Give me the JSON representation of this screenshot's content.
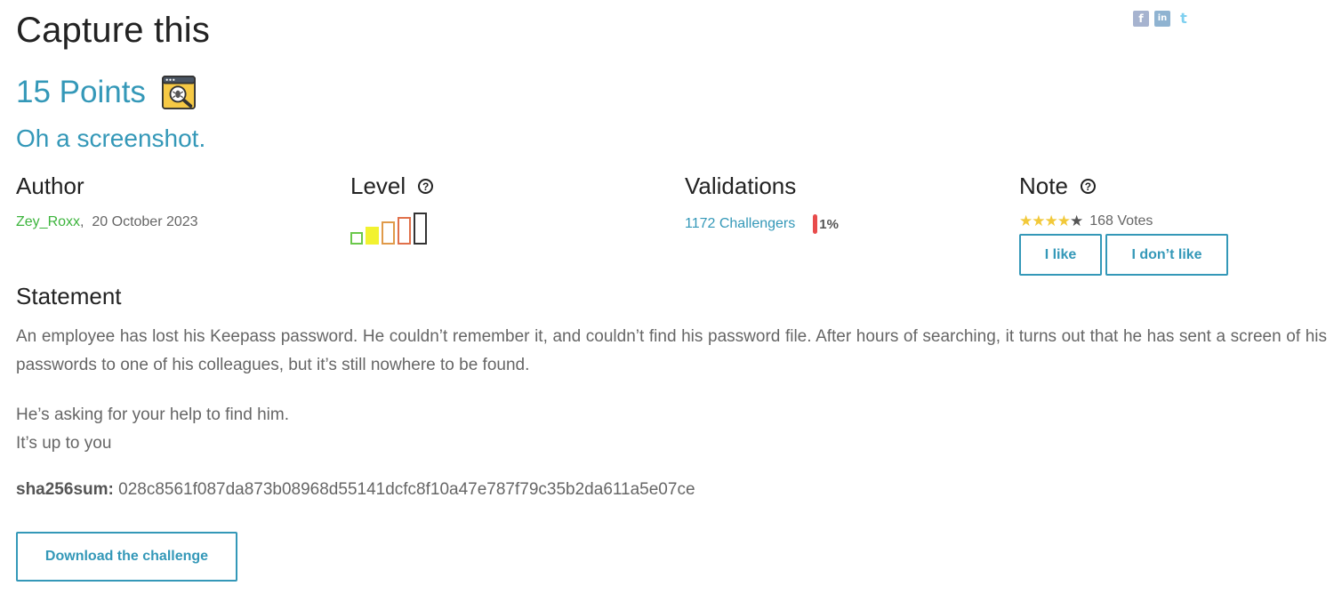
{
  "challenge": {
    "title": "Capture this",
    "points": "15 Points",
    "category_icon": "forensics-bug-magnifier-icon",
    "subtitle": "Oh a screenshot."
  },
  "share": {
    "icons": [
      "facebook-icon",
      "linkedin-icon",
      "twitter-icon"
    ],
    "facebook_glyph": "f",
    "linkedin_glyph": "in",
    "twitter_glyph": "t"
  },
  "author": {
    "heading": "Author",
    "name": "Zey_Roxx",
    "separator": ",",
    "date": "20 October 2023"
  },
  "level": {
    "heading": "Level",
    "help_glyph": "?",
    "bars_total": 5,
    "bars_filled": 2
  },
  "validations": {
    "heading": "Validations",
    "challengers": "1172 Challengers",
    "percent": "1%"
  },
  "note": {
    "heading": "Note",
    "help_glyph": "?",
    "rating_stars": 4,
    "max_stars": 5,
    "votes": "168 Votes",
    "like_label": "I like",
    "dislike_label": "I don’t like"
  },
  "statement": {
    "heading": "Statement",
    "paragraph1": "An employee has lost his Keepass password. He couldn’t remember it, and couldn’t find his password file. After hours of searching, it turns out that he has sent a screen of his passwords to one of his colleagues, but it’s still nowhere to be found.",
    "paragraph2_line1": "He’s asking for your help to find him.",
    "paragraph2_line2": "It’s up to you",
    "sha_label": "sha256sum:",
    "sha_value": "028c8561f087da873b08968d55141dcfc8f10a47e787f79c35b2da611a5e07ce"
  },
  "download": {
    "label": "Download the challenge"
  },
  "colors": {
    "accent": "#3498b8",
    "author_link": "#3cb43c",
    "percent_bar": "#e84c4c",
    "star": "#f2c93a"
  }
}
